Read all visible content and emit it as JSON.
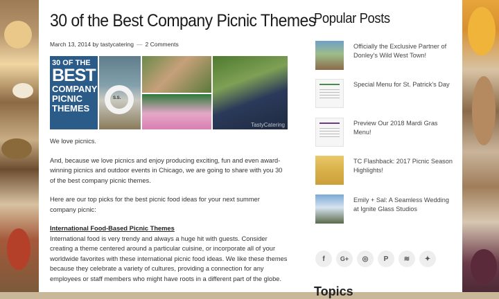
{
  "article": {
    "title": "30 of the Best Company Picnic Themes",
    "date": "March 13, 2014",
    "by": "by",
    "author": "tastycatering",
    "separator": "—",
    "comments": "2 Comments",
    "image": {
      "line1": "30 OF THE",
      "line2": "BEST",
      "line3": "COMPANY",
      "line4": "PICNIC",
      "line5": "THEMES",
      "life_ring_text": "S.S.",
      "watermark": "TastyCatering"
    },
    "paragraphs": [
      "We love picnics.",
      "And, because we love picnics and enjoy producing exciting, fun and even award-winning picnics and outdoor events in Chicago, we are going to share with you 30 of the best company picnic themes.",
      "Here are our top picks for the best picnic food ideas for your next summer company picnic:"
    ],
    "section_heading": "International Food-Based Picnic Themes",
    "section_text": "International food is very trendy and always a huge hit with guests.  Consider creating a theme centered around a particular cuisine, or incorporate all of your worldwide favorites with these international picnic food ideas.  We like these themes because they celebrate a variety of cultures, providing a connection for any employees or staff members who might have roots in a different part of the globe."
  },
  "sidebar": {
    "title": "Popular Posts",
    "posts": [
      {
        "title": "Officially the Exclusive Partner of Donley's Wild West Town!"
      },
      {
        "title": "Special Menu for St. Patrick's Day"
      },
      {
        "title": "Preview Our 2018 Mardi Gras Menu!"
      },
      {
        "title": "TC Flashback: 2017 Picnic Season Highlights!"
      },
      {
        "title": "Emily + Sal: A Seamless Wedding at Ignite Glass Studios"
      }
    ],
    "social": [
      "f",
      "G+",
      "◎",
      "P",
      "≋",
      "✦"
    ],
    "topics_title": "Topics"
  }
}
